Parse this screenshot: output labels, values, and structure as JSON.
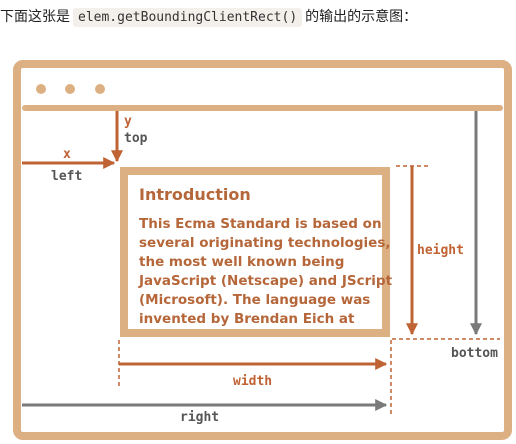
{
  "caption": {
    "prefix": "下面这张是",
    "code": "elem.getBoundingClientRect()",
    "suffix": "的输出的示意图："
  },
  "element": {
    "heading": "Introduction",
    "body_lines": [
      "This Ecma Standard is based on",
      "several originating technologies,",
      "the most well known being",
      "JavaScript (Netscape) and JScript",
      "(Microsoft). The language was",
      "invented by Brendan Eich at"
    ]
  },
  "labels": {
    "x": "x",
    "left": "left",
    "y": "y",
    "top": "top",
    "height": "height",
    "bottom": "bottom",
    "width": "width",
    "right": "right"
  },
  "colors": {
    "frame": "#ddb083",
    "text": "#b5673a",
    "arrow_orange": "#c06334",
    "arrow_gray": "#7a7a7a",
    "label_dark": "#555555"
  }
}
